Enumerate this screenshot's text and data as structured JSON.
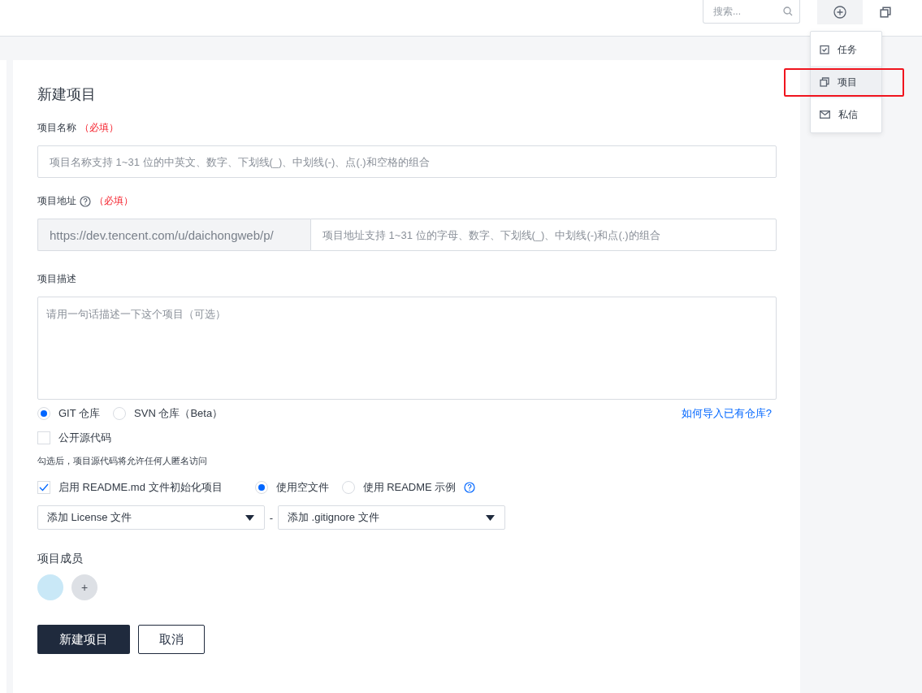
{
  "topbar": {
    "search": {
      "placeholder": "搜索..."
    },
    "create_button_active": true
  },
  "menu": {
    "items": [
      {
        "label": "任务",
        "kind": "task",
        "selected": false
      },
      {
        "label": "项目",
        "kind": "project",
        "selected": true
      },
      {
        "label": "私信",
        "kind": "message",
        "selected": false
      }
    ]
  },
  "form": {
    "title": "新建项目",
    "name_field": {
      "label": "项目名称",
      "required": "（必填）",
      "placeholder": "项目名称支持 1~31 位的中英文、数字、下划线(_)、中划线(-)、点(.)和空格的组合"
    },
    "address_field": {
      "label": "项目地址",
      "required": "（必填）",
      "prefix": "https://dev.tencent.com/u/daichongweb/p/",
      "placeholder": "项目地址支持 1~31 位的字母、数字、下划线(_)、中划线(-)和点(.)的组合"
    },
    "description_field": {
      "label": "项目描述",
      "placeholder": "请用一句话描述一下这个项目（可选）"
    },
    "repo_types": [
      {
        "label": "GIT 仓库",
        "selected": true
      },
      {
        "label": "SVN 仓库（Beta）",
        "selected": false
      }
    ],
    "import_link": "如何导入已有仓库?",
    "public_source": {
      "label": "公开源代码",
      "checked": false
    },
    "public_hint": "勾选后，项目源代码将允许任何人匿名访问",
    "readme": {
      "label": "启用 README.md 文件初始化项目",
      "checked": true
    },
    "readme_options": [
      {
        "label": "使用空文件",
        "selected": true,
        "help": false
      },
      {
        "label": "使用 README 示例",
        "selected": false,
        "help": true
      }
    ],
    "license_select": "添加 License 文件",
    "separator": "-",
    "gitignore_select": "添加 .gitignore 文件",
    "members_title": "项目成员",
    "add_member": "+",
    "submit": "新建项目",
    "cancel": "取消"
  }
}
